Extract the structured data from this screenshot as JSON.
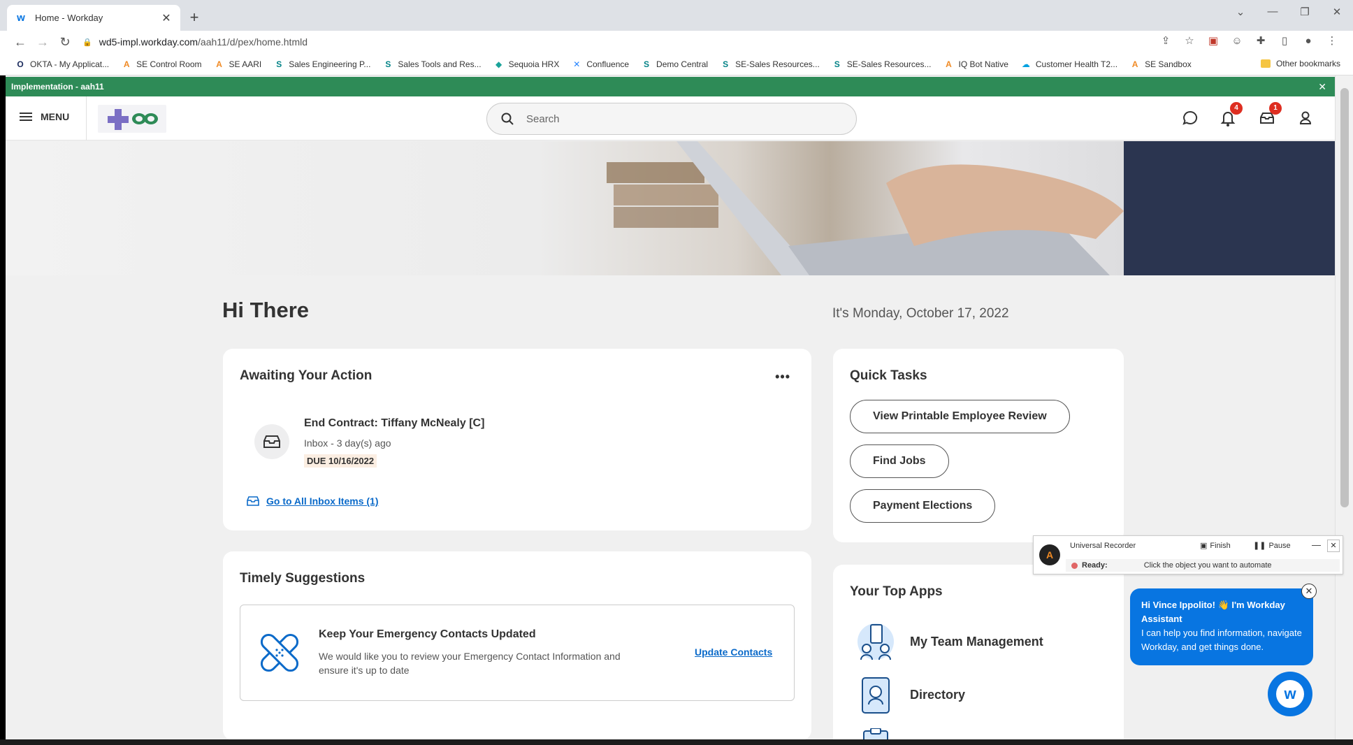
{
  "browser": {
    "tab_title": "Home - Workday",
    "url_host": "wd5-impl.workday.com",
    "url_path": "/aah11/d/pex/home.htmld",
    "bookmarks": [
      {
        "label": "OKTA - My Applicat...",
        "icon": "okta-icon",
        "color": "#1a2a5c",
        "glyph": "O"
      },
      {
        "label": "SE Control Room",
        "icon": "automation-anywhere-icon",
        "color": "#f08a24",
        "glyph": "A"
      },
      {
        "label": "SE AARI",
        "icon": "automation-anywhere-icon",
        "color": "#f08a24",
        "glyph": "A"
      },
      {
        "label": "Sales Engineering P...",
        "icon": "sharepoint-icon",
        "color": "#038387",
        "glyph": "S"
      },
      {
        "label": "Sales Tools and Res...",
        "icon": "sharepoint-icon",
        "color": "#038387",
        "glyph": "S"
      },
      {
        "label": "Sequoia HRX",
        "icon": "sequoia-icon",
        "color": "#1aa39a",
        "glyph": "◆"
      },
      {
        "label": "Confluence",
        "icon": "confluence-icon",
        "color": "#2684ff",
        "glyph": "✕"
      },
      {
        "label": "Demo Central",
        "icon": "sharepoint-icon",
        "color": "#038387",
        "glyph": "S"
      },
      {
        "label": "SE-Sales Resources...",
        "icon": "sharepoint-icon",
        "color": "#038387",
        "glyph": "S"
      },
      {
        "label": "SE-Sales Resources...",
        "icon": "sharepoint-icon",
        "color": "#038387",
        "glyph": "S"
      },
      {
        "label": "IQ Bot Native",
        "icon": "automation-anywhere-icon",
        "color": "#f08a24",
        "glyph": "A"
      },
      {
        "label": "Customer Health T2...",
        "icon": "salesforce-icon",
        "color": "#00a1e0",
        "glyph": "☁"
      },
      {
        "label": "SE Sandbox",
        "icon": "automation-anywhere-icon",
        "color": "#f08a24",
        "glyph": "A"
      }
    ],
    "other_bookmarks": "Other bookmarks"
  },
  "env_banner": "Implementation - aah11",
  "header": {
    "menu_label": "MENU",
    "search_placeholder": "Search",
    "notifications_count": "4",
    "inbox_count": "1"
  },
  "greeting": "Hi There",
  "date_text": "It's Monday, October 17, 2022",
  "awaiting": {
    "title": "Awaiting Your Action",
    "item_title": "End Contract: Tiffany McNealy [C]",
    "item_meta": "Inbox - 3 day(s) ago",
    "item_due": "DUE 10/16/2022",
    "inbox_link": "Go to All Inbox Items (1)"
  },
  "quick_tasks": {
    "title": "Quick Tasks",
    "buttons": [
      "View Printable Employee Review",
      "Find Jobs",
      "Payment Elections"
    ]
  },
  "timely": {
    "title": "Timely Suggestions",
    "suggestion_title": "Keep Your Emergency Contacts Updated",
    "suggestion_desc": "We would like you to review your Emergency Contact Information and ensure it's up to date",
    "suggestion_link": "Update Contacts"
  },
  "top_apps": {
    "title": "Your Top Apps",
    "apps": [
      "My Team Management",
      "Directory"
    ]
  },
  "recorder": {
    "title": "Universal Recorder",
    "finish": "Finish",
    "pause": "Pause",
    "status_label": "Ready:",
    "status_text": "Click the object you want to automate"
  },
  "assistant": {
    "greeting": "Hi Vince Ippolito! 👋 I'm Workday Assistant",
    "body": "I can help you find information, navigate Workday, and get things done."
  },
  "colors": {
    "workday_blue": "#0875e1",
    "env_green": "#2e8b57",
    "badge_red": "#de2e21"
  }
}
